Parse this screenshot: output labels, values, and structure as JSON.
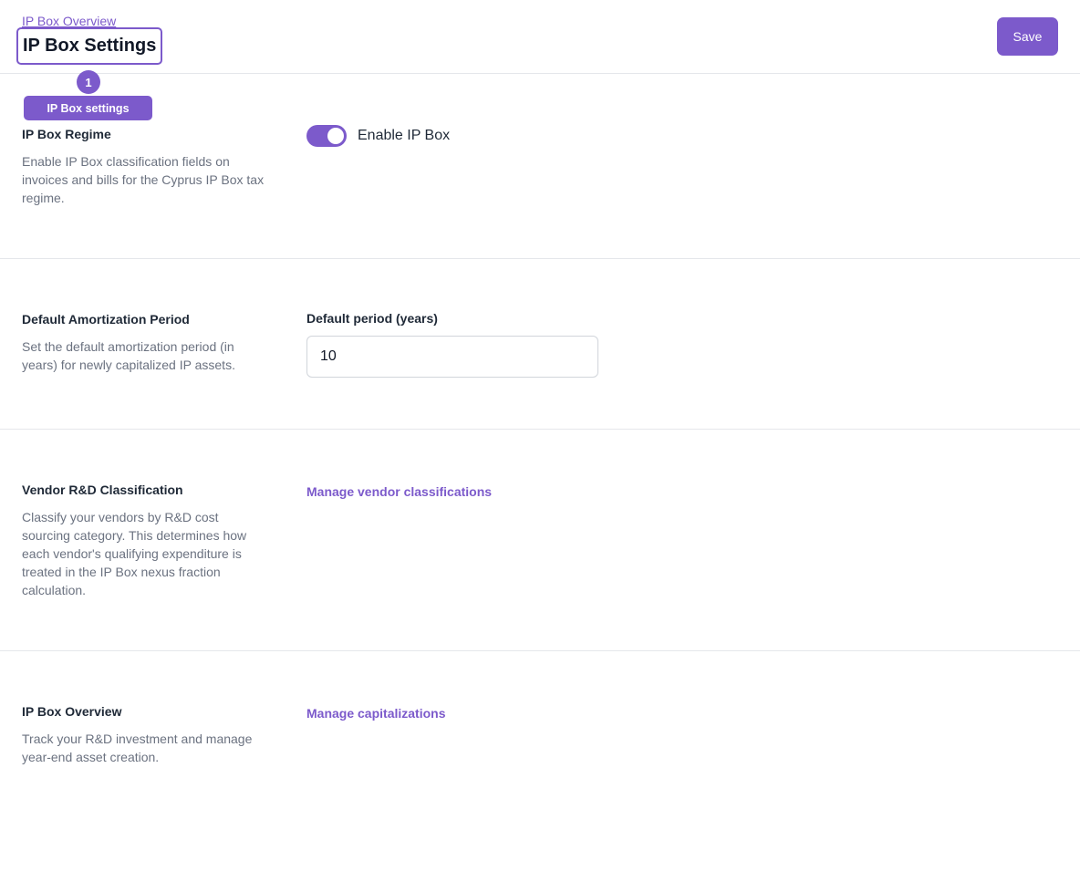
{
  "header": {
    "breadcrumb": "IP Box Overview",
    "title": "IP Box Settings",
    "save_label": "Save"
  },
  "tour": {
    "step": "1",
    "label": "IP Box settings"
  },
  "sections": {
    "regime": {
      "heading": "IP Box Regime",
      "description": "Enable IP Box classification fields on invoices and bills for the Cyprus IP Box tax regime.",
      "toggle_label": "Enable IP Box",
      "toggle_on": true
    },
    "amortization": {
      "heading": "Default Amortization Period",
      "description": "Set the default amortization period (in years) for newly capitalized IP assets.",
      "field_label": "Default period (years)",
      "field_value": "10"
    },
    "vendor": {
      "heading": "Vendor R&D Classification",
      "description": "Classify your vendors by R&D cost sourcing category. This determines how each vendor's qualifying expenditure is treated in the IP Box nexus fraction calculation.",
      "link": "Manage vendor classifications"
    },
    "overview": {
      "heading": "IP Box Overview",
      "description": "Track your R&D investment and manage year-end asset creation.",
      "link": "Manage capitalizations"
    }
  },
  "colors": {
    "accent": "#7c5acb",
    "divider": "#e5e7eb",
    "muted_text": "#6b7280"
  }
}
